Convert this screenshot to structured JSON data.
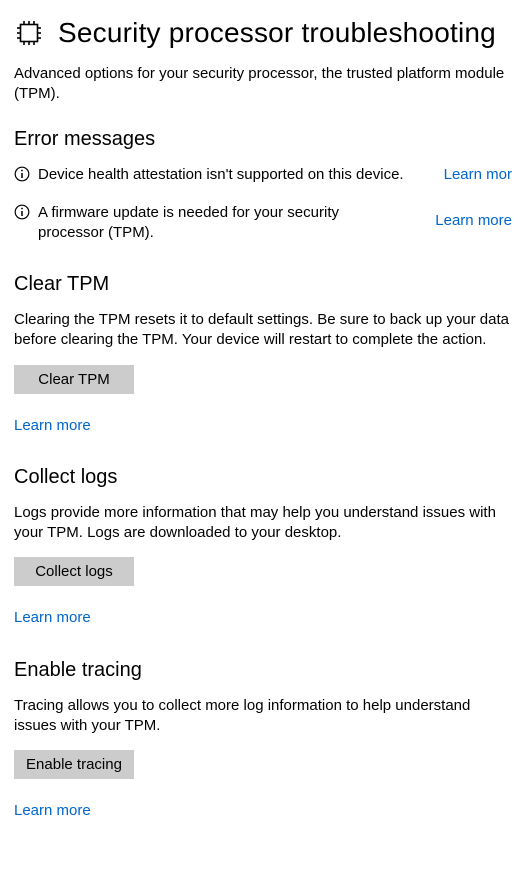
{
  "header": {
    "title": "Security processor troubleshooting",
    "description": "Advanced options for your security processor, the trusted platform module (TPM)."
  },
  "errors": {
    "heading": "Error messages",
    "items": [
      {
        "message": "Device health attestation isn't supported on this device.",
        "link": "Learn mor"
      },
      {
        "message": "A firmware update is needed for your security processor (TPM).",
        "link": "Learn more"
      }
    ]
  },
  "clear_tpm": {
    "heading": "Clear TPM",
    "description": "Clearing the TPM resets it to default settings. Be sure to back up your data before clearing the TPM. Your device will restart to complete the action.",
    "button": "Clear TPM",
    "learn_more": "Learn more"
  },
  "collect_logs": {
    "heading": "Collect logs",
    "description": "Logs provide more information that may help you understand issues with your TPM.  Logs are downloaded to your desktop.",
    "button": "Collect logs",
    "learn_more": "Learn more"
  },
  "enable_tracing": {
    "heading": "Enable tracing",
    "description": "Tracing allows you to collect more log information to help understand issues with your TPM.",
    "button": "Enable tracing",
    "learn_more": "Learn more"
  }
}
